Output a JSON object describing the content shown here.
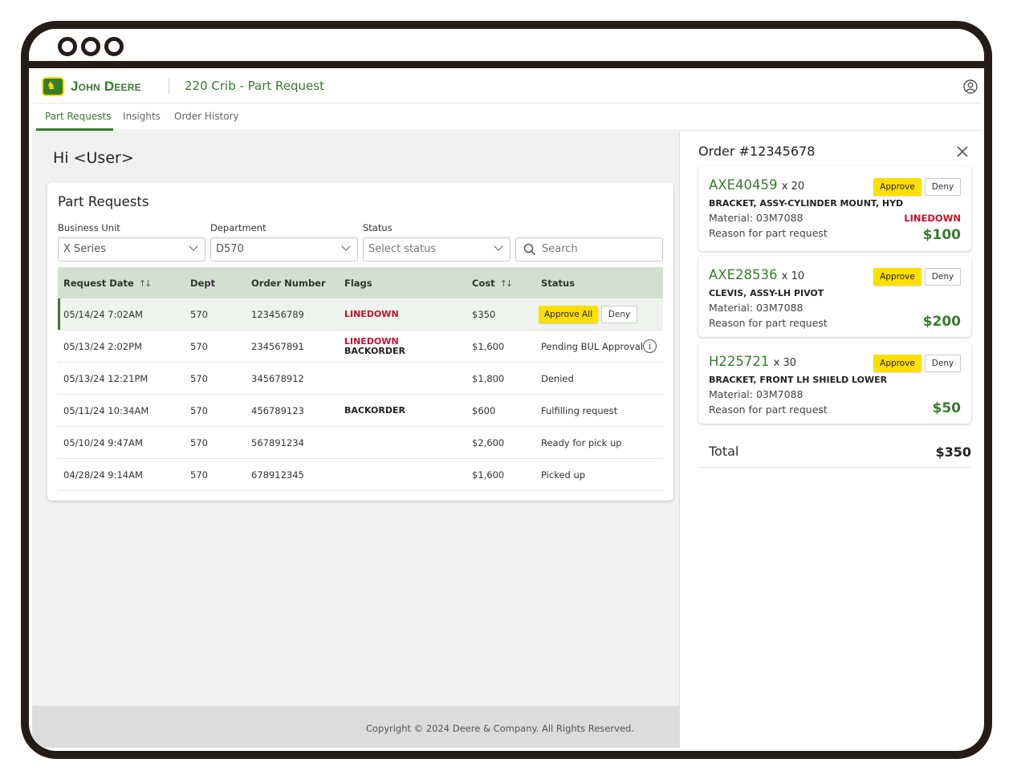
{
  "header": {
    "brand": "John Deere",
    "app_title": "220 Crib - Part Request"
  },
  "tabs": [
    {
      "label": "Part Requests",
      "active": true
    },
    {
      "label": "Insights",
      "active": false
    },
    {
      "label": "Order History",
      "active": false
    }
  ],
  "main": {
    "greeting": "Hi <User>",
    "card_title": "Part Requests",
    "filters": {
      "business_unit": {
        "label": "Business Unit",
        "value": "X Series"
      },
      "department": {
        "label": "Department",
        "value": "D570"
      },
      "status": {
        "label": "Status",
        "placeholder": "Select status"
      },
      "search": {
        "placeholder": "Search"
      }
    },
    "table": {
      "columns": [
        "Request Date",
        "Dept",
        "Order Number",
        "Flags",
        "Cost",
        "Status"
      ],
      "rows": [
        {
          "date": "05/14/24 7:02AM",
          "dept": "570",
          "order": "123456789",
          "flags": [
            "LINEDOWN"
          ],
          "cost": "$350",
          "status": "",
          "actions": {
            "approve": "Approve All",
            "deny": "Deny"
          }
        },
        {
          "date": "05/13/24 2:02PM",
          "dept": "570",
          "order": "234567891",
          "flags": [
            "LINEDOWN",
            "BACKORDER"
          ],
          "cost": "$1,600",
          "status": "Pending BUL Approval"
        },
        {
          "date": "05/13/24 12:21PM",
          "dept": "570",
          "order": "345678912",
          "flags": [],
          "cost": "$1,800",
          "status": "Denied"
        },
        {
          "date": "05/11/24 10:34AM",
          "dept": "570",
          "order": "456789123",
          "flags": [
            "BACKORDER"
          ],
          "cost": "$600",
          "status": "Fulfilling request"
        },
        {
          "date": "05/10/24 9:47AM",
          "dept": "570",
          "order": "567891234",
          "flags": [],
          "cost": "$2,600",
          "status": "Ready for pick up"
        },
        {
          "date": "04/28/24 9:14AM",
          "dept": "570",
          "order": "678912345",
          "flags": [],
          "cost": "$1,600",
          "status": "Picked up"
        }
      ]
    },
    "footer": "Copyright © 2024 Deere & Company. All Rights Reserved."
  },
  "panel": {
    "title": "Order #12345678",
    "items": [
      {
        "part": "AXE40459",
        "qty": "x 20",
        "name": "BRACKET, ASSY-CYLINDER MOUNT, HYD",
        "material": "Material: 03M7088",
        "reason": "Reason for part request",
        "flag": "LINEDOWN",
        "price": "$100",
        "approve": "Approve",
        "deny": "Deny"
      },
      {
        "part": "AXE28536",
        "qty": "x 10",
        "name": "CLEVIS, ASSY-LH PIVOT",
        "material": "Material: 03M7088",
        "reason": "Reason for part request",
        "flag": "",
        "price": "$200",
        "approve": "Approve",
        "deny": "Deny"
      },
      {
        "part": "H225721",
        "qty": "x 30",
        "name": "BRACKET, FRONT LH SHIELD LOWER",
        "material": "Material: 03M7088",
        "reason": "Reason for part request",
        "flag": "",
        "price": "$50",
        "approve": "Approve",
        "deny": "Deny"
      }
    ],
    "total_label": "Total",
    "total_value": "$350"
  },
  "colors": {
    "brand_green": "#367c2b",
    "brand_yellow": "#ffde00",
    "flag_red": "#c8102e",
    "table_header": "#d2e0d0"
  }
}
